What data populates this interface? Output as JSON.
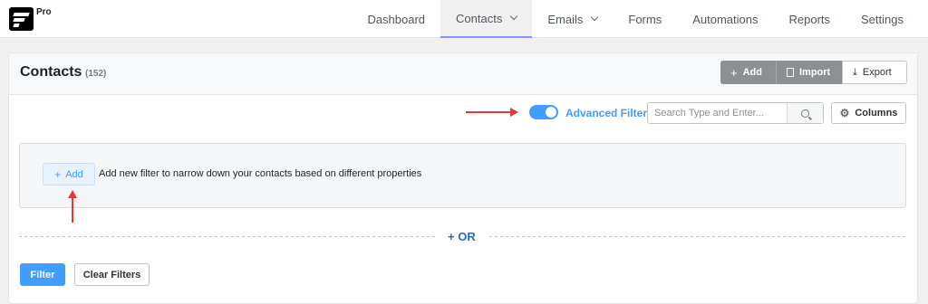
{
  "brand": {
    "badge": "Pro"
  },
  "nav": {
    "items": [
      {
        "label": "Dashboard",
        "active": false,
        "dropdown": false
      },
      {
        "label": "Contacts",
        "active": true,
        "dropdown": true
      },
      {
        "label": "Emails",
        "active": false,
        "dropdown": true
      },
      {
        "label": "Forms",
        "active": false,
        "dropdown": false
      },
      {
        "label": "Automations",
        "active": false,
        "dropdown": false
      },
      {
        "label": "Reports",
        "active": false,
        "dropdown": false
      },
      {
        "label": "Settings",
        "active": false,
        "dropdown": false
      }
    ]
  },
  "header": {
    "title": "Contacts",
    "count": "(152)",
    "buttons": {
      "add": "Add",
      "import": "Import",
      "export": "Export"
    }
  },
  "toolbar": {
    "advanced_filter_label": "Advanced Filter",
    "advanced_filter_on": true,
    "search_placeholder": "Search Type and Enter...",
    "columns_label": "Columns"
  },
  "filter": {
    "add_label": "Add",
    "description": "Add new filter to narrow down your contacts based on different properties",
    "or_label": "+ OR"
  },
  "actions": {
    "filter_label": "Filter",
    "clear_label": "Clear Filters"
  },
  "colors": {
    "accent": "#409eff",
    "annotation_arrow": "#e53935",
    "or_text": "#2271b1"
  }
}
